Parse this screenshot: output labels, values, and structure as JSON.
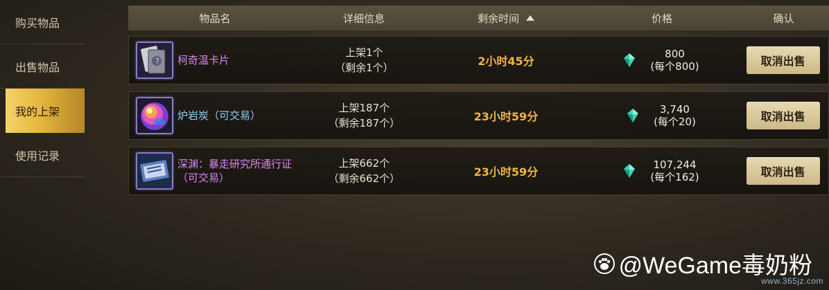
{
  "sidebar": {
    "items": [
      {
        "label": "购买物品"
      },
      {
        "label": "出售物品"
      },
      {
        "label": "我的上架"
      },
      {
        "label": "使用记录"
      }
    ]
  },
  "table": {
    "headers": {
      "name": "物品名",
      "detail": "详细信息",
      "time": "剩余时间",
      "price": "价格",
      "confirm": "确认"
    },
    "rows": [
      {
        "name": "柯奇温卡片",
        "name_line2": "",
        "listed": "上架1个",
        "remaining": "（剩余1个）",
        "time_left": "2小时45分",
        "price_total": "800",
        "price_each": "(每个800)",
        "action": "取消出售",
        "icon": "card-icon"
      },
      {
        "name": "炉岩炭（可交易）",
        "name_line2": "",
        "listed": "上架187个",
        "remaining": "（剩余187个）",
        "time_left": "23小时59分",
        "price_total": "3,740",
        "price_each": "(每个20)",
        "action": "取消出售",
        "icon": "orb-icon"
      },
      {
        "name": "深渊：暴走研究所通行证",
        "name_line2": "（可交易）",
        "listed": "上架662个",
        "remaining": "（剩余662个）",
        "time_left": "23小时59分",
        "price_total": "107,244",
        "price_each": "(每个162)",
        "action": "取消出售",
        "icon": "pass-ticket-icon"
      }
    ]
  },
  "watermark": {
    "text": "@WeGame毒奶粉",
    "site": "www.365jz.com"
  },
  "colors": {
    "active_tab": "#e4b53c",
    "time_text": "#f0b648",
    "purple_name": "#d68af0",
    "blue_name": "#8fd2f2",
    "button": "#d8c79a"
  }
}
